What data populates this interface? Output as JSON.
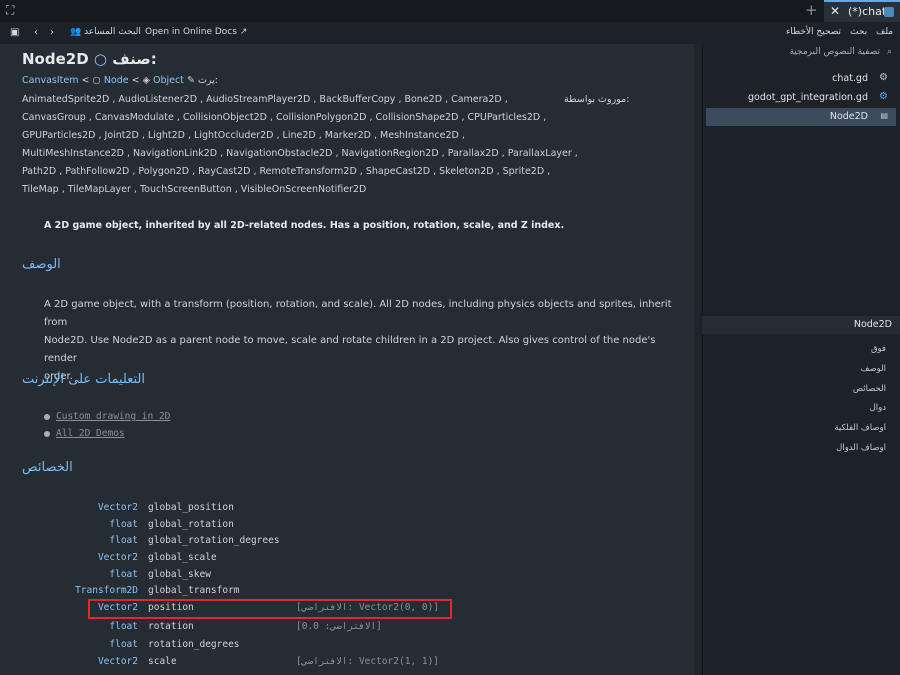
{
  "tabs": {
    "active_label": "(*)chat"
  },
  "menu": {
    "file": "ملف",
    "search": "بحث",
    "debug": "تصحيح الأخطاء",
    "online_docs": "Open in Online Docs",
    "help_search": "البحث المساعد"
  },
  "doc": {
    "title": "Node2D",
    "class_word": "صنف:",
    "inherits_label": "يرث:",
    "inherits": [
      "CanvasItem",
      "Node",
      "Object"
    ],
    "inherited_by_label": "موروث بواسطة:",
    "inherited_lines": [
      "AnimatedSprite2D , AudioListener2D , AudioStreamPlayer2D , BackBufferCopy , Bone2D , Camera2D ,",
      "CanvasGroup , CanvasModulate , CollisionObject2D , CollisionPolygon2D , CollisionShape2D , CPUParticles2D ,",
      "GPUParticles2D , Joint2D , Light2D , LightOccluder2D , Line2D , Marker2D , MeshInstance2D ,",
      "MultiMeshInstance2D , NavigationLink2D , NavigationObstacle2D , NavigationRegion2D , Parallax2D , ParallaxLayer ,",
      "Path2D , PathFollow2D , Polygon2D , RayCast2D , RemoteTransform2D , ShapeCast2D , Skeleton2D , Sprite2D ,",
      "TileMap , TileMapLayer , TouchScreenButton , VisibleOnScreenNotifier2D"
    ],
    "brief": "A 2D game object, inherited by all 2D-related nodes. Has a position, rotation, scale, and Z index.",
    "desc_heading": "الوصف",
    "desc_line1": "A 2D game object, with a transform (position, rotation, and scale). All 2D nodes, including physics objects and sprites, inherit from",
    "desc_line2": "Node2D. Use Node2D as a parent node to move, scale and rotate children in a 2D project. Also gives control of the node's render",
    "desc_line3": "order.",
    "tutorials_heading": "التعليمات على الإنترنت",
    "tutorials": [
      "Custom drawing in 2D",
      "All 2D Demos"
    ],
    "props_heading": "الخصائص",
    "properties": [
      {
        "type": "Vector2",
        "name": "global_position",
        "default": ""
      },
      {
        "type": "float",
        "name": "global_rotation",
        "default": ""
      },
      {
        "type": "float",
        "name": "global_rotation_degrees",
        "default": ""
      },
      {
        "type": "Vector2",
        "name": "global_scale",
        "default": ""
      },
      {
        "type": "float",
        "name": "global_skew",
        "default": ""
      },
      {
        "type": "Transform2D",
        "name": "global_transform",
        "default": ""
      },
      {
        "type": "Vector2",
        "name": "position",
        "default": "[الافتراضي: Vector2(0, 0)]"
      },
      {
        "type": "float",
        "name": "rotation",
        "default": "[الافتراضي: 0.0]"
      },
      {
        "type": "float",
        "name": "rotation_degrees",
        "default": ""
      },
      {
        "type": "Vector2",
        "name": "scale",
        "default": "[الافتراضي: Vector2(1, 1)]"
      }
    ]
  },
  "side": {
    "filter_placeholder": "تصفية النصوص البرمجية",
    "files": [
      "chat.gd",
      "godot_gpt_integration.gd",
      "Node2D"
    ],
    "outline_title": "Node2D",
    "outline": [
      "فوق",
      "الوصف",
      "الخصائص",
      "دوال",
      "اوصاف الفلكية",
      "اوصاف الدوال"
    ]
  },
  "colors": {
    "accent": "#5da9f5",
    "highlight_box": "#e0282d"
  }
}
